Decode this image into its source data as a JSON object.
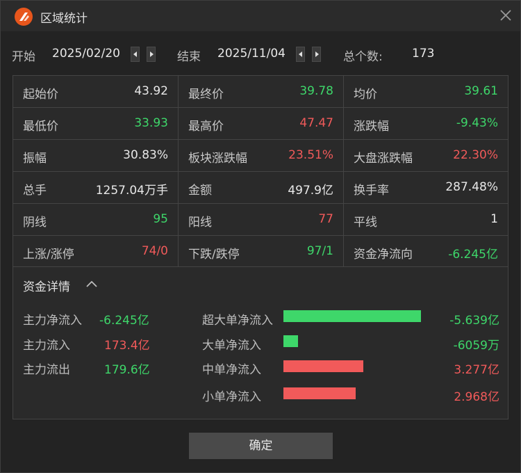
{
  "window": {
    "title": "区域统计"
  },
  "range": {
    "start_label": "开始",
    "start_value": "2025/02/20",
    "end_label": "结束",
    "end_value": "2025/11/04",
    "count_label": "总个数:",
    "count_value": "173"
  },
  "stats": [
    [
      {
        "k": "起始价",
        "v": "43.92"
      },
      {
        "k": "最终价",
        "v": "39.78"
      },
      {
        "k": "均价",
        "v": "39.61"
      }
    ],
    [
      {
        "k": "最低价",
        "v": "33.93"
      },
      {
        "k": "最高价",
        "v": "47.47"
      },
      {
        "k": "涨跌幅",
        "v": "-9.43%"
      }
    ],
    [
      {
        "k": "振幅",
        "v": "30.83%"
      },
      {
        "k": "板块涨跌幅",
        "v": "23.51%"
      },
      {
        "k": "大盘涨跌幅",
        "v": "22.30%"
      }
    ],
    [
      {
        "k": "总手",
        "v": "1257.04万手"
      },
      {
        "k": "金额",
        "v": "497.9亿"
      },
      {
        "k": "换手率",
        "v": "287.48%"
      }
    ],
    [
      {
        "k": "阴线",
        "v": "95"
      },
      {
        "k": "阳线",
        "v": "77"
      },
      {
        "k": "平线",
        "v": "1"
      }
    ],
    [
      {
        "k": "上涨/涨停",
        "v": "74/0"
      },
      {
        "k": "下跌/跌停",
        "v": "97/1"
      },
      {
        "k": "资金净流向",
        "v": "-6.245亿"
      }
    ]
  ],
  "colors": {
    "up": "#f15a5a",
    "down": "#3ed76a",
    "neutral": "#e8e8e8"
  },
  "detail": {
    "header": "资金详情",
    "left": [
      {
        "label": "主力净流入",
        "value": "-6.245亿"
      },
      {
        "label": "主力流入",
        "value": "173.4亿"
      },
      {
        "label": "主力流出",
        "value": "179.6亿"
      }
    ],
    "flows": [
      {
        "label": "超大单净流入",
        "value": "-5.639亿",
        "amount": -5.639
      },
      {
        "label": "大单净流入",
        "value": "-6059万",
        "amount": -0.6059
      },
      {
        "label": "中单净流入",
        "value": "3.277亿",
        "amount": 3.277
      },
      {
        "label": "小单净流入",
        "value": "2.968亿",
        "amount": 2.968
      }
    ]
  },
  "ok_label": "确定",
  "icons": {
    "logo": "app-logo-icon",
    "close": "close-icon",
    "collapse": "chevron-up-icon"
  }
}
